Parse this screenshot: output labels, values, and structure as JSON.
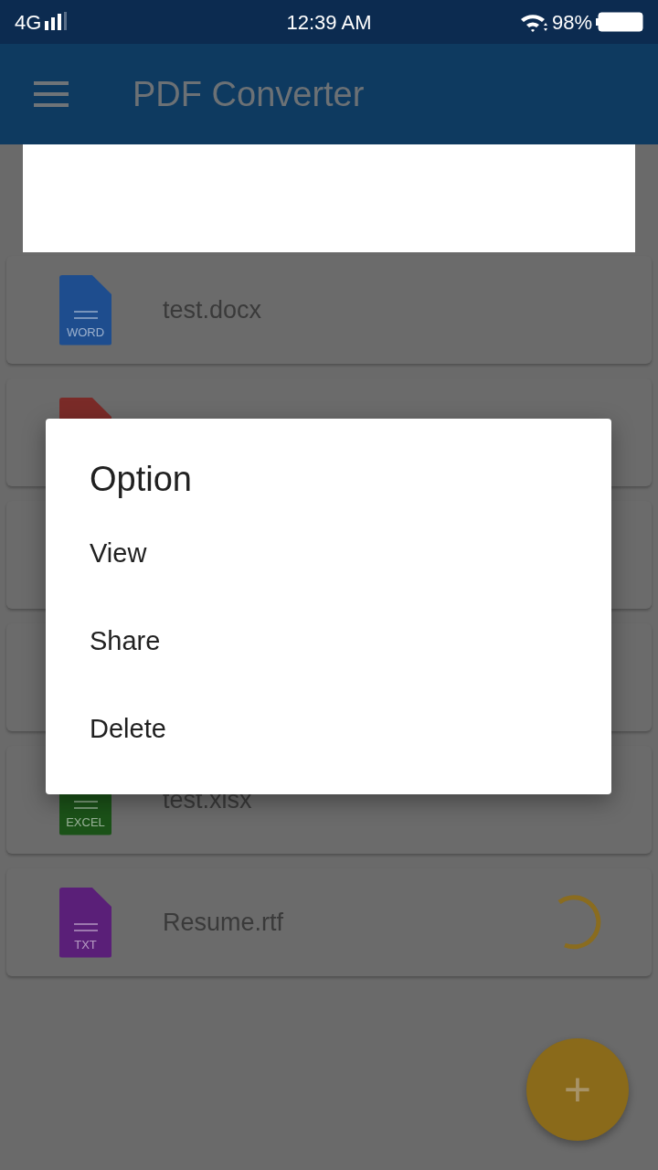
{
  "status_bar": {
    "network": "4G",
    "time": "12:39 AM",
    "battery": "98%"
  },
  "app_bar": {
    "title": "PDF Converter"
  },
  "files": [
    {
      "kind": "file",
      "name": "test.docx",
      "type_label": "WORD",
      "color": "#1e4d8e",
      "loading": false
    },
    {
      "kind": "file",
      "color": "#7a2b28"
    },
    {
      "kind": "covered"
    },
    {
      "kind": "covered"
    },
    {
      "kind": "file",
      "name": "test.xlsx",
      "type_label": "EXCEL",
      "color": "#1b5218",
      "loading": false
    },
    {
      "kind": "file",
      "name": "Resume.rtf",
      "type_label": "TXT",
      "color": "#5a1f78",
      "loading": true
    }
  ],
  "dialog": {
    "title": "Option",
    "items": [
      "View",
      "Share",
      "Delete"
    ]
  },
  "fab": {
    "label": "+"
  }
}
